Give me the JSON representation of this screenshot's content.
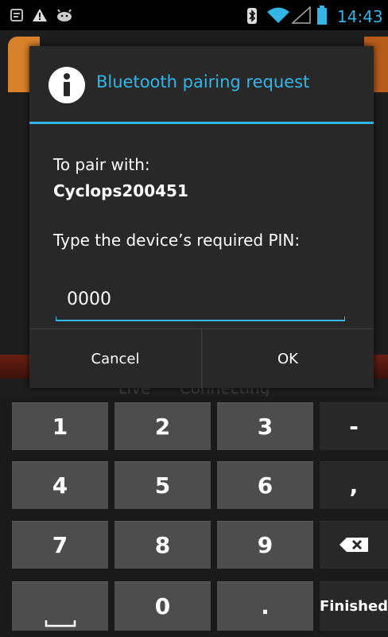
{
  "status_bar": {
    "time": "14:43",
    "icons": [
      "notification-icon",
      "warning-icon",
      "android-icon",
      "bluetooth-icon",
      "wifi-icon",
      "signal-icon",
      "battery-icon"
    ]
  },
  "background_app": {
    "status_text": "Live Connecting"
  },
  "dialog": {
    "title": "Bluetooth pairing request",
    "icon": "info-icon",
    "pair_label": "To pair with:",
    "device_name": "Cyclops200451",
    "pin_prompt": "Type the device’s required PIN:",
    "pin_value": "0000",
    "cancel_label": "Cancel",
    "ok_label": "OK"
  },
  "keypad": {
    "keys": [
      "1",
      "2",
      "3",
      "-",
      "4",
      "5",
      "6",
      ",",
      "7",
      "8",
      "9",
      "0",
      ".",
      "Finished"
    ],
    "icons": [
      "backspace-icon",
      "space-icon"
    ]
  },
  "colors": {
    "accent": "#33b5e5",
    "dialog_bg": "#282828",
    "key_bg": "#4d4d4d",
    "fn_key_bg": "#282828"
  }
}
